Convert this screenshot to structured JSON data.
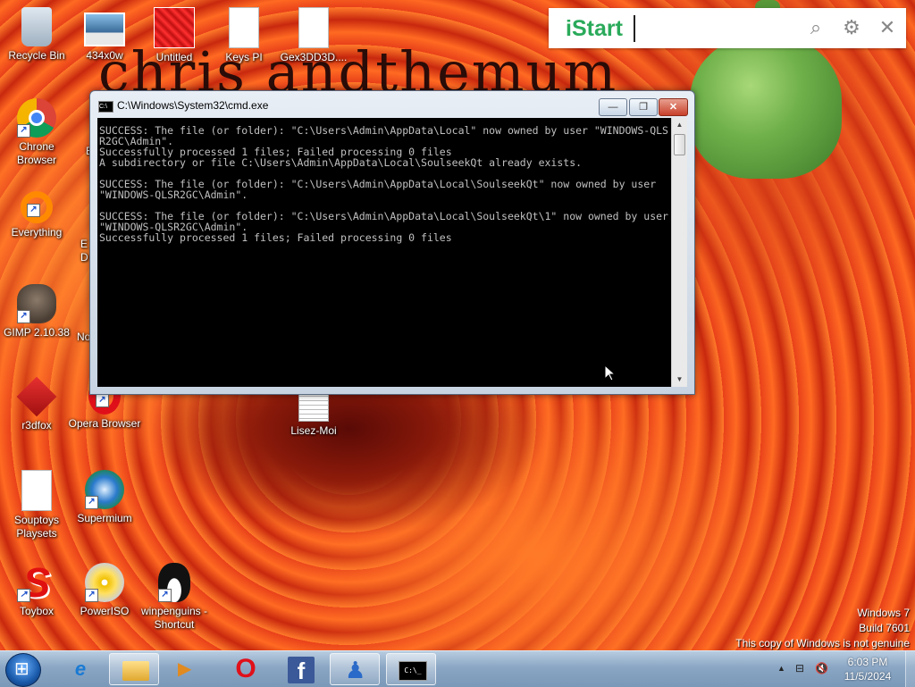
{
  "wallpaper": {
    "text": "chris andthemum"
  },
  "desktop_icons": [
    {
      "label": "Recycle Bin"
    },
    {
      "label": "434x0w"
    },
    {
      "label": "Untitled"
    },
    {
      "label": "Keys PI"
    },
    {
      "label": "Gex3DD3D...."
    },
    {
      "label": "Chrone Browser"
    },
    {
      "label": "Everything"
    },
    {
      "label": "GIMP 2.10.38"
    },
    {
      "label": "r3dfox"
    },
    {
      "label": "Opera Browser"
    },
    {
      "label": "Lisez-Moi"
    },
    {
      "label": "Souptoys Playsets"
    },
    {
      "label": "Supermium"
    },
    {
      "label": "Toybox"
    },
    {
      "label": "PowerISO"
    },
    {
      "label": "winpenguins - Shortcut"
    },
    {
      "label": "E"
    },
    {
      "label": "E"
    },
    {
      "label": "D"
    },
    {
      "label": "No"
    }
  ],
  "istart": {
    "logo": "iStart",
    "input_value": "",
    "search_icon": "search-icon",
    "settings_icon": "gear-icon",
    "close_icon": "close-icon"
  },
  "cmd": {
    "title": "C:\\Windows\\System32\\cmd.exe",
    "buttons": {
      "minimize": "—",
      "maximize": "❐",
      "close": "✕"
    },
    "output": "SUCCESS: The file (or folder): \"C:\\Users\\Admin\\AppData\\Local\" now owned by user \"WINDOWS-QLSR2GC\\Admin\".\nSuccessfully processed 1 files; Failed processing 0 files\nA subdirectory or file C:\\Users\\Admin\\AppData\\Local\\SoulseekQt already exists.\n\nSUCCESS: The file (or folder): \"C:\\Users\\Admin\\AppData\\Local\\SoulseekQt\" now owned by user \"WINDOWS-QLSR2GC\\Admin\".\n\nSUCCESS: The file (or folder): \"C:\\Users\\Admin\\AppData\\Local\\SoulseekQt\\1\" now owned by user \"WINDOWS-QLSR2GC\\Admin\".\nSuccessfully processed 1 files; Failed processing 0 files"
  },
  "watermark": {
    "line1": "Windows 7",
    "line2": "Build 7601",
    "line3": "This copy of Windows is not genuine"
  },
  "taskbar": {
    "pinned": [
      {
        "name": "internet-explorer-icon",
        "glyph": "e"
      },
      {
        "name": "windows-explorer-icon",
        "glyph": ""
      },
      {
        "name": "media-player-icon",
        "glyph": ""
      },
      {
        "name": "opera-icon",
        "glyph": "O"
      },
      {
        "name": "facebook-icon",
        "glyph": ""
      },
      {
        "name": "messenger-icon",
        "glyph": ""
      },
      {
        "name": "cmd-icon",
        "glyph": ""
      }
    ],
    "tray": {
      "arrow": "▲",
      "network": "⊟",
      "volume": "🔇"
    },
    "clock": {
      "time": "6:03 PM",
      "date": "11/5/2024"
    }
  },
  "colors": {
    "istart_logo": "#2aaa5a",
    "cmd_text": "#c0c0c0",
    "taskbar": "#8aa6c4"
  }
}
